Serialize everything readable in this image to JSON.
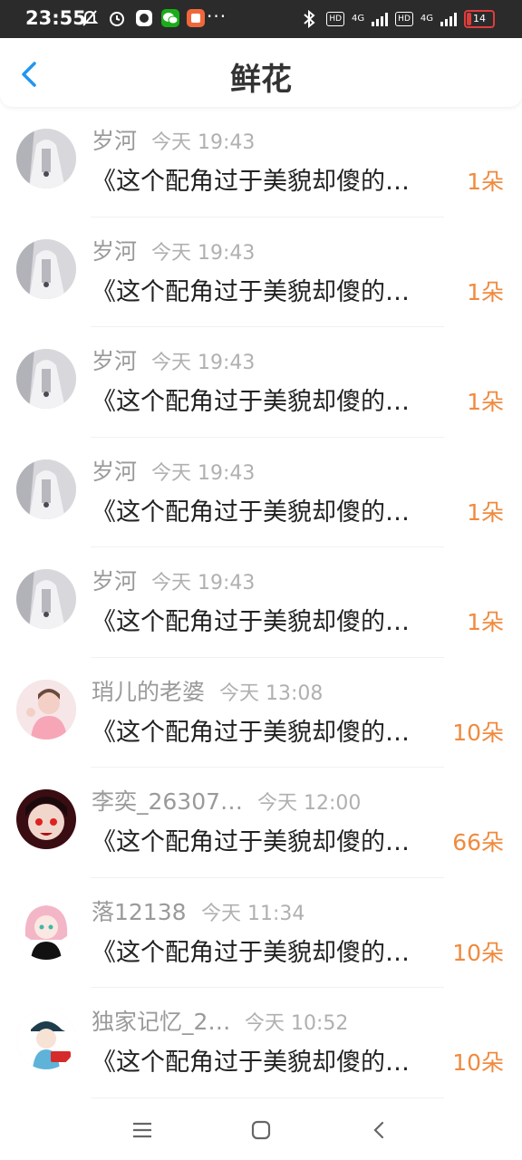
{
  "status_bar": {
    "time": "23:55",
    "more": "···",
    "network_1": "4G",
    "network_2": "4G",
    "hd": "HD",
    "battery": "14",
    "icons": [
      "mute-icon",
      "alarm-icon",
      "app-icon",
      "wechat-icon",
      "app-icon",
      "bluetooth-icon",
      "signal-icon",
      "battery-icon"
    ]
  },
  "header": {
    "title": "鲜花",
    "back_icon": "chevron-left-icon"
  },
  "colors": {
    "accent": "#2196f3",
    "count": "#f08a3e",
    "name": "#9a9a9a",
    "text": "#222222"
  },
  "list": [
    {
      "name": "岁河",
      "time": "今天 19:43",
      "message": "《这个配角过于美貌却傻的…",
      "count": "1朵",
      "avatar": "grey-figure"
    },
    {
      "name": "岁河",
      "time": "今天 19:43",
      "message": "《这个配角过于美貌却傻的…",
      "count": "1朵",
      "avatar": "grey-figure"
    },
    {
      "name": "岁河",
      "time": "今天 19:43",
      "message": "《这个配角过于美貌却傻的…",
      "count": "1朵",
      "avatar": "grey-figure"
    },
    {
      "name": "岁河",
      "time": "今天 19:43",
      "message": "《这个配角过于美貌却傻的…",
      "count": "1朵",
      "avatar": "grey-figure"
    },
    {
      "name": "岁河",
      "time": "今天 19:43",
      "message": "《这个配角过于美貌却傻的…",
      "count": "1朵",
      "avatar": "grey-figure"
    },
    {
      "name": "琑儿的老婆",
      "time": "今天 13:08",
      "message": "《这个配角过于美貌却傻的…",
      "count": "10朵",
      "avatar": "pink-person"
    },
    {
      "name": "李奕_26307…",
      "time": "今天 12:00",
      "message": "《这个配角过于美貌却傻的…",
      "count": "66朵",
      "avatar": "dark-red-anime"
    },
    {
      "name": "落12138",
      "time": "今天 11:34",
      "message": "《这个配角过于美貌却傻的…",
      "count": "10朵",
      "avatar": "pink-hair-anime"
    },
    {
      "name": "独家记忆_2…",
      "time": "今天 10:52",
      "message": "《这个配角过于美貌却傻的…",
      "count": "10朵",
      "avatar": "cap-boy-anime"
    }
  ],
  "navbar": {
    "icons": [
      "menu-icon",
      "home-icon",
      "back-icon"
    ]
  }
}
